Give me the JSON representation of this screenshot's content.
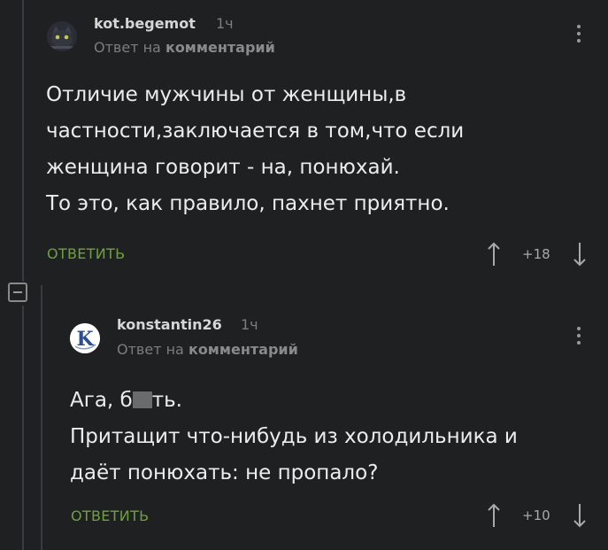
{
  "comments": [
    {
      "username": "kot.begemot",
      "time": "1ч",
      "reply_prefix": "Ответ на",
      "reply_target": "комментарий",
      "lines": [
        "Отличие мужчины от женщины,в",
        "частности,заключается в том,что если",
        "женщина говорит - на, понюхай.",
        "То это, как правило, пахнет приятно."
      ],
      "reply_label": "ОТВЕТИТЬ",
      "rating": "+18",
      "avatar_icon": "cat-avatar-icon"
    },
    {
      "username": "konstantin26",
      "time": "1ч",
      "reply_prefix": "Ответ на",
      "reply_target": "комментарий",
      "line1_before": "Ага, б",
      "line1_after": "ть.",
      "lines": [
        "Притащит что-нибудь из холодильника и",
        "даёт понюхать: не пропало?"
      ],
      "reply_label": "ОТВЕТИТЬ",
      "rating": "+10",
      "avatar_icon": "k-logo-avatar-icon"
    }
  ],
  "colors": {
    "background": "#1f2022",
    "accent": "#6ea23c",
    "text": "#ececec",
    "muted": "#7d7d7d"
  }
}
